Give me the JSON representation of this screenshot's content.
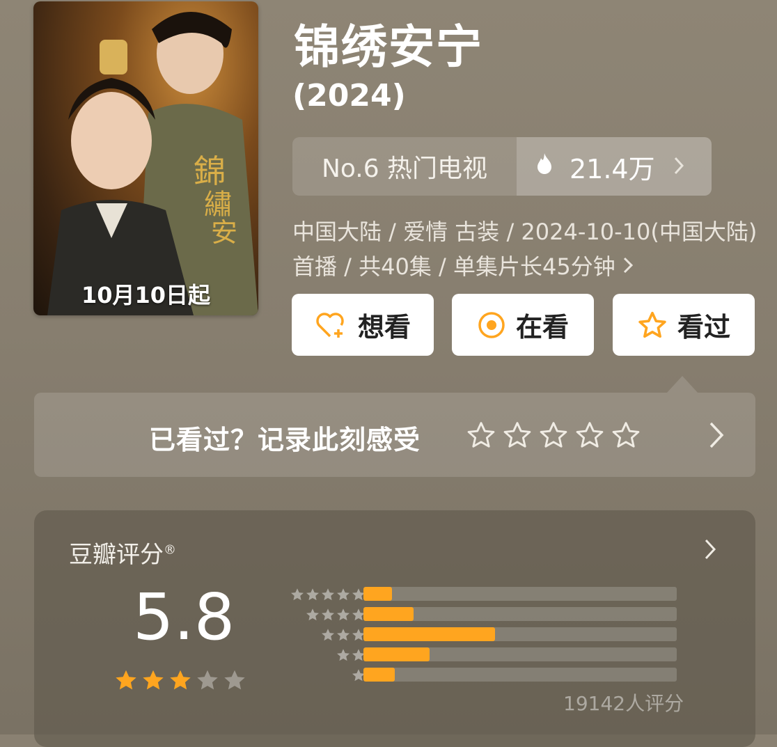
{
  "poster": {
    "caption": "10月10日起"
  },
  "title": "锦绣安宁",
  "year": "(2024)",
  "rank": {
    "label": "No.6 热门电视",
    "heat": "21.4万"
  },
  "meta": "中国大陆 / 爱情 古装 / 2024-10-10(中国大陆)首播 / 共40集 / 单集片长45分钟",
  "actions": {
    "want": "想看",
    "watching": "在看",
    "watched": "看过"
  },
  "record": {
    "prompt": "已看过？记录此刻感受"
  },
  "rating": {
    "label": "豆瓣评分",
    "mark": "®",
    "score": "5.8",
    "score_stars": 3,
    "count": "19142人评分",
    "distribution": [
      {
        "stars": 5,
        "share": 0.09
      },
      {
        "stars": 4,
        "share": 0.16
      },
      {
        "stars": 3,
        "share": 0.42
      },
      {
        "stars": 2,
        "share": 0.21
      },
      {
        "stars": 1,
        "share": 0.1
      }
    ]
  },
  "colors": {
    "accent": "#ffa51f",
    "star_on": "#ffa51f"
  }
}
